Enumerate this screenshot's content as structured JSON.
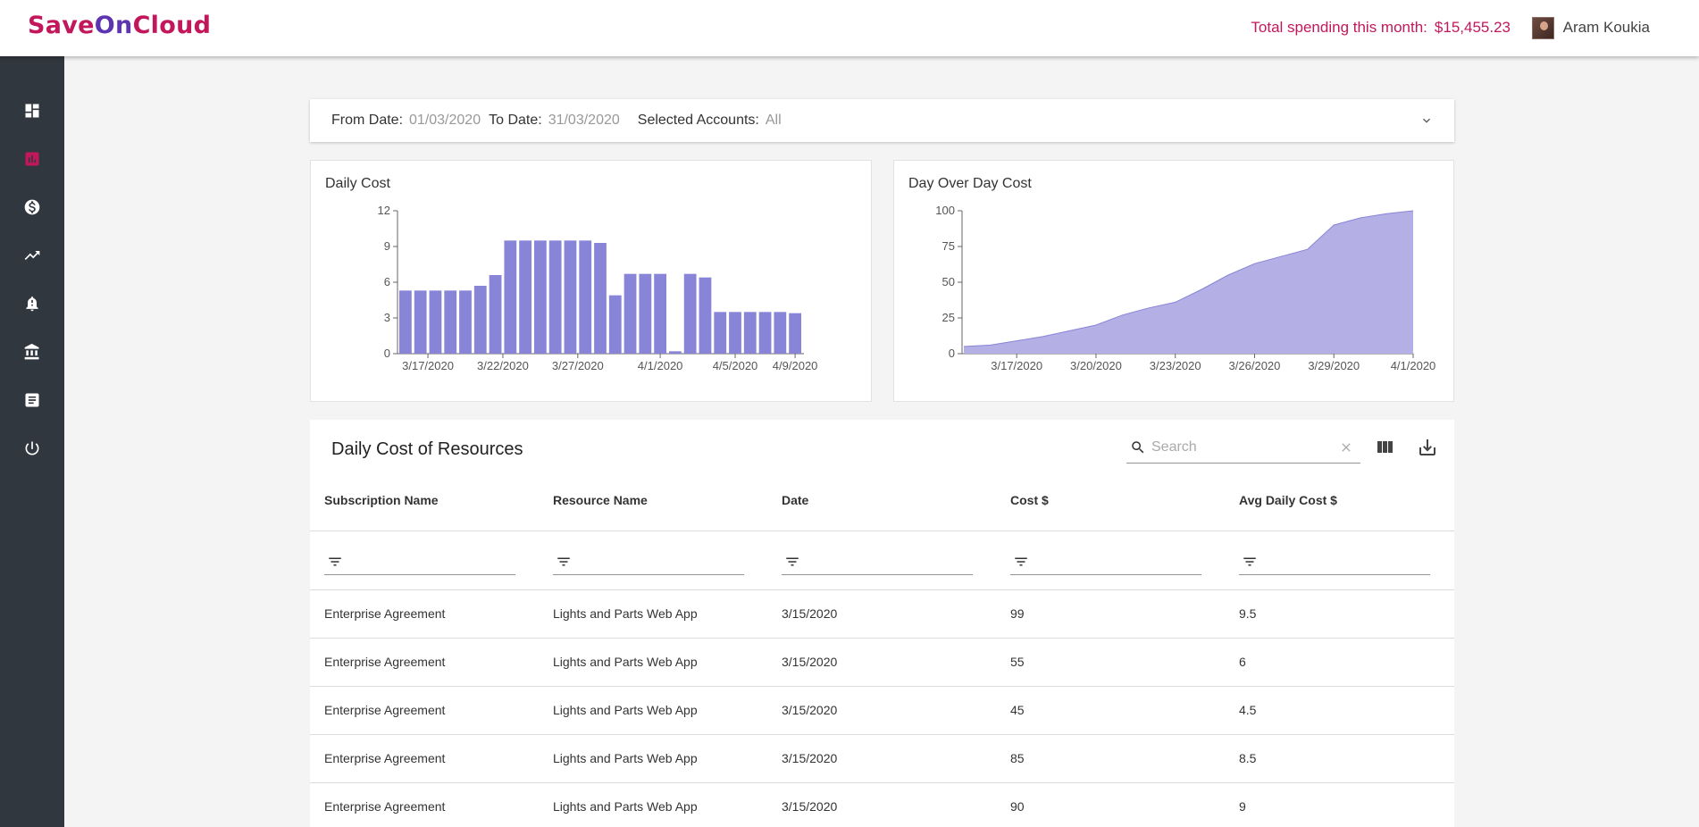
{
  "brand": {
    "part1": "Save",
    "part2": "On",
    "part3": "Cloud"
  },
  "header": {
    "spending_label": "Total spending this month:",
    "spending_value": "$15,455.23",
    "user_name": "Aram Koukia"
  },
  "sidebar": {
    "items": [
      {
        "icon": "dashboard-icon",
        "active": false
      },
      {
        "icon": "chart-icon",
        "active": true
      },
      {
        "icon": "dollar-icon",
        "active": false
      },
      {
        "icon": "trending-icon",
        "active": false
      },
      {
        "icon": "alert-bell-icon",
        "active": false
      },
      {
        "icon": "bank-icon",
        "active": false
      },
      {
        "icon": "document-icon",
        "active": false
      },
      {
        "icon": "power-icon",
        "active": false
      }
    ]
  },
  "filters": {
    "from_label": "From Date:",
    "from_value": "01/03/2020",
    "to_label": "To Date:",
    "to_value": "31/03/2020",
    "accounts_label": "Selected Accounts:",
    "accounts_value": "All"
  },
  "chart_data": [
    {
      "type": "bar",
      "title": "Daily Cost",
      "ylim": [
        0,
        12
      ],
      "yticks": [
        "0",
        "3",
        "6",
        "9",
        "12"
      ],
      "xticks": [
        {
          "label": "3/17/2020",
          "index": 1.5
        },
        {
          "label": "3/22/2020",
          "index": 6.5
        },
        {
          "label": "3/27/2020",
          "index": 11.5
        },
        {
          "label": "4/1/2020",
          "index": 17
        },
        {
          "label": "4/5/2020",
          "index": 22
        },
        {
          "label": "4/9/2020",
          "index": 26
        }
      ],
      "values": [
        5.3,
        5.3,
        5.3,
        5.3,
        5.3,
        5.7,
        6.6,
        9.5,
        9.5,
        9.5,
        9.5,
        9.5,
        9.5,
        9.3,
        4.9,
        6.7,
        6.7,
        6.7,
        0.2,
        6.7,
        6.4,
        3.5,
        3.5,
        3.5,
        3.5,
        3.5,
        3.4
      ],
      "color": "#8884d8"
    },
    {
      "type": "area",
      "title": "Day Over Day Cost",
      "ylim": [
        0,
        100
      ],
      "yticks": [
        "0",
        "25",
        "50",
        "75",
        "100"
      ],
      "xticks": [
        {
          "label": "3/17/2020",
          "index": 2
        },
        {
          "label": "3/20/2020",
          "index": 5
        },
        {
          "label": "3/23/2020",
          "index": 8
        },
        {
          "label": "3/26/2020",
          "index": 11
        },
        {
          "label": "3/29/2020",
          "index": 14
        },
        {
          "label": "4/1/2020",
          "index": 17
        }
      ],
      "values": [
        5,
        6,
        9,
        12,
        16,
        20,
        27,
        32,
        36,
        45,
        55,
        63,
        68,
        73,
        90,
        95,
        98,
        100
      ],
      "color": "#b4b0e6",
      "stroke": "#8884d8"
    }
  ],
  "table": {
    "title": "Daily Cost of Resources",
    "search_placeholder": "Search",
    "columns": [
      "Subscription Name",
      "Resource Name",
      "Date",
      "Cost $",
      "Avg Daily Cost $"
    ],
    "rows": [
      [
        "Enterprise Agreement",
        "Lights and Parts Web App",
        "3/15/2020",
        "99",
        "9.5"
      ],
      [
        "Enterprise Agreement",
        "Lights and Parts Web App",
        "3/15/2020",
        "55",
        "6"
      ],
      [
        "Enterprise Agreement",
        "Lights and Parts Web App",
        "3/15/2020",
        "45",
        "4.5"
      ],
      [
        "Enterprise Agreement",
        "Lights and Parts Web App",
        "3/15/2020",
        "85",
        "8.5"
      ],
      [
        "Enterprise Agreement",
        "Lights and Parts Web App",
        "3/15/2020",
        "90",
        "9"
      ]
    ]
  }
}
